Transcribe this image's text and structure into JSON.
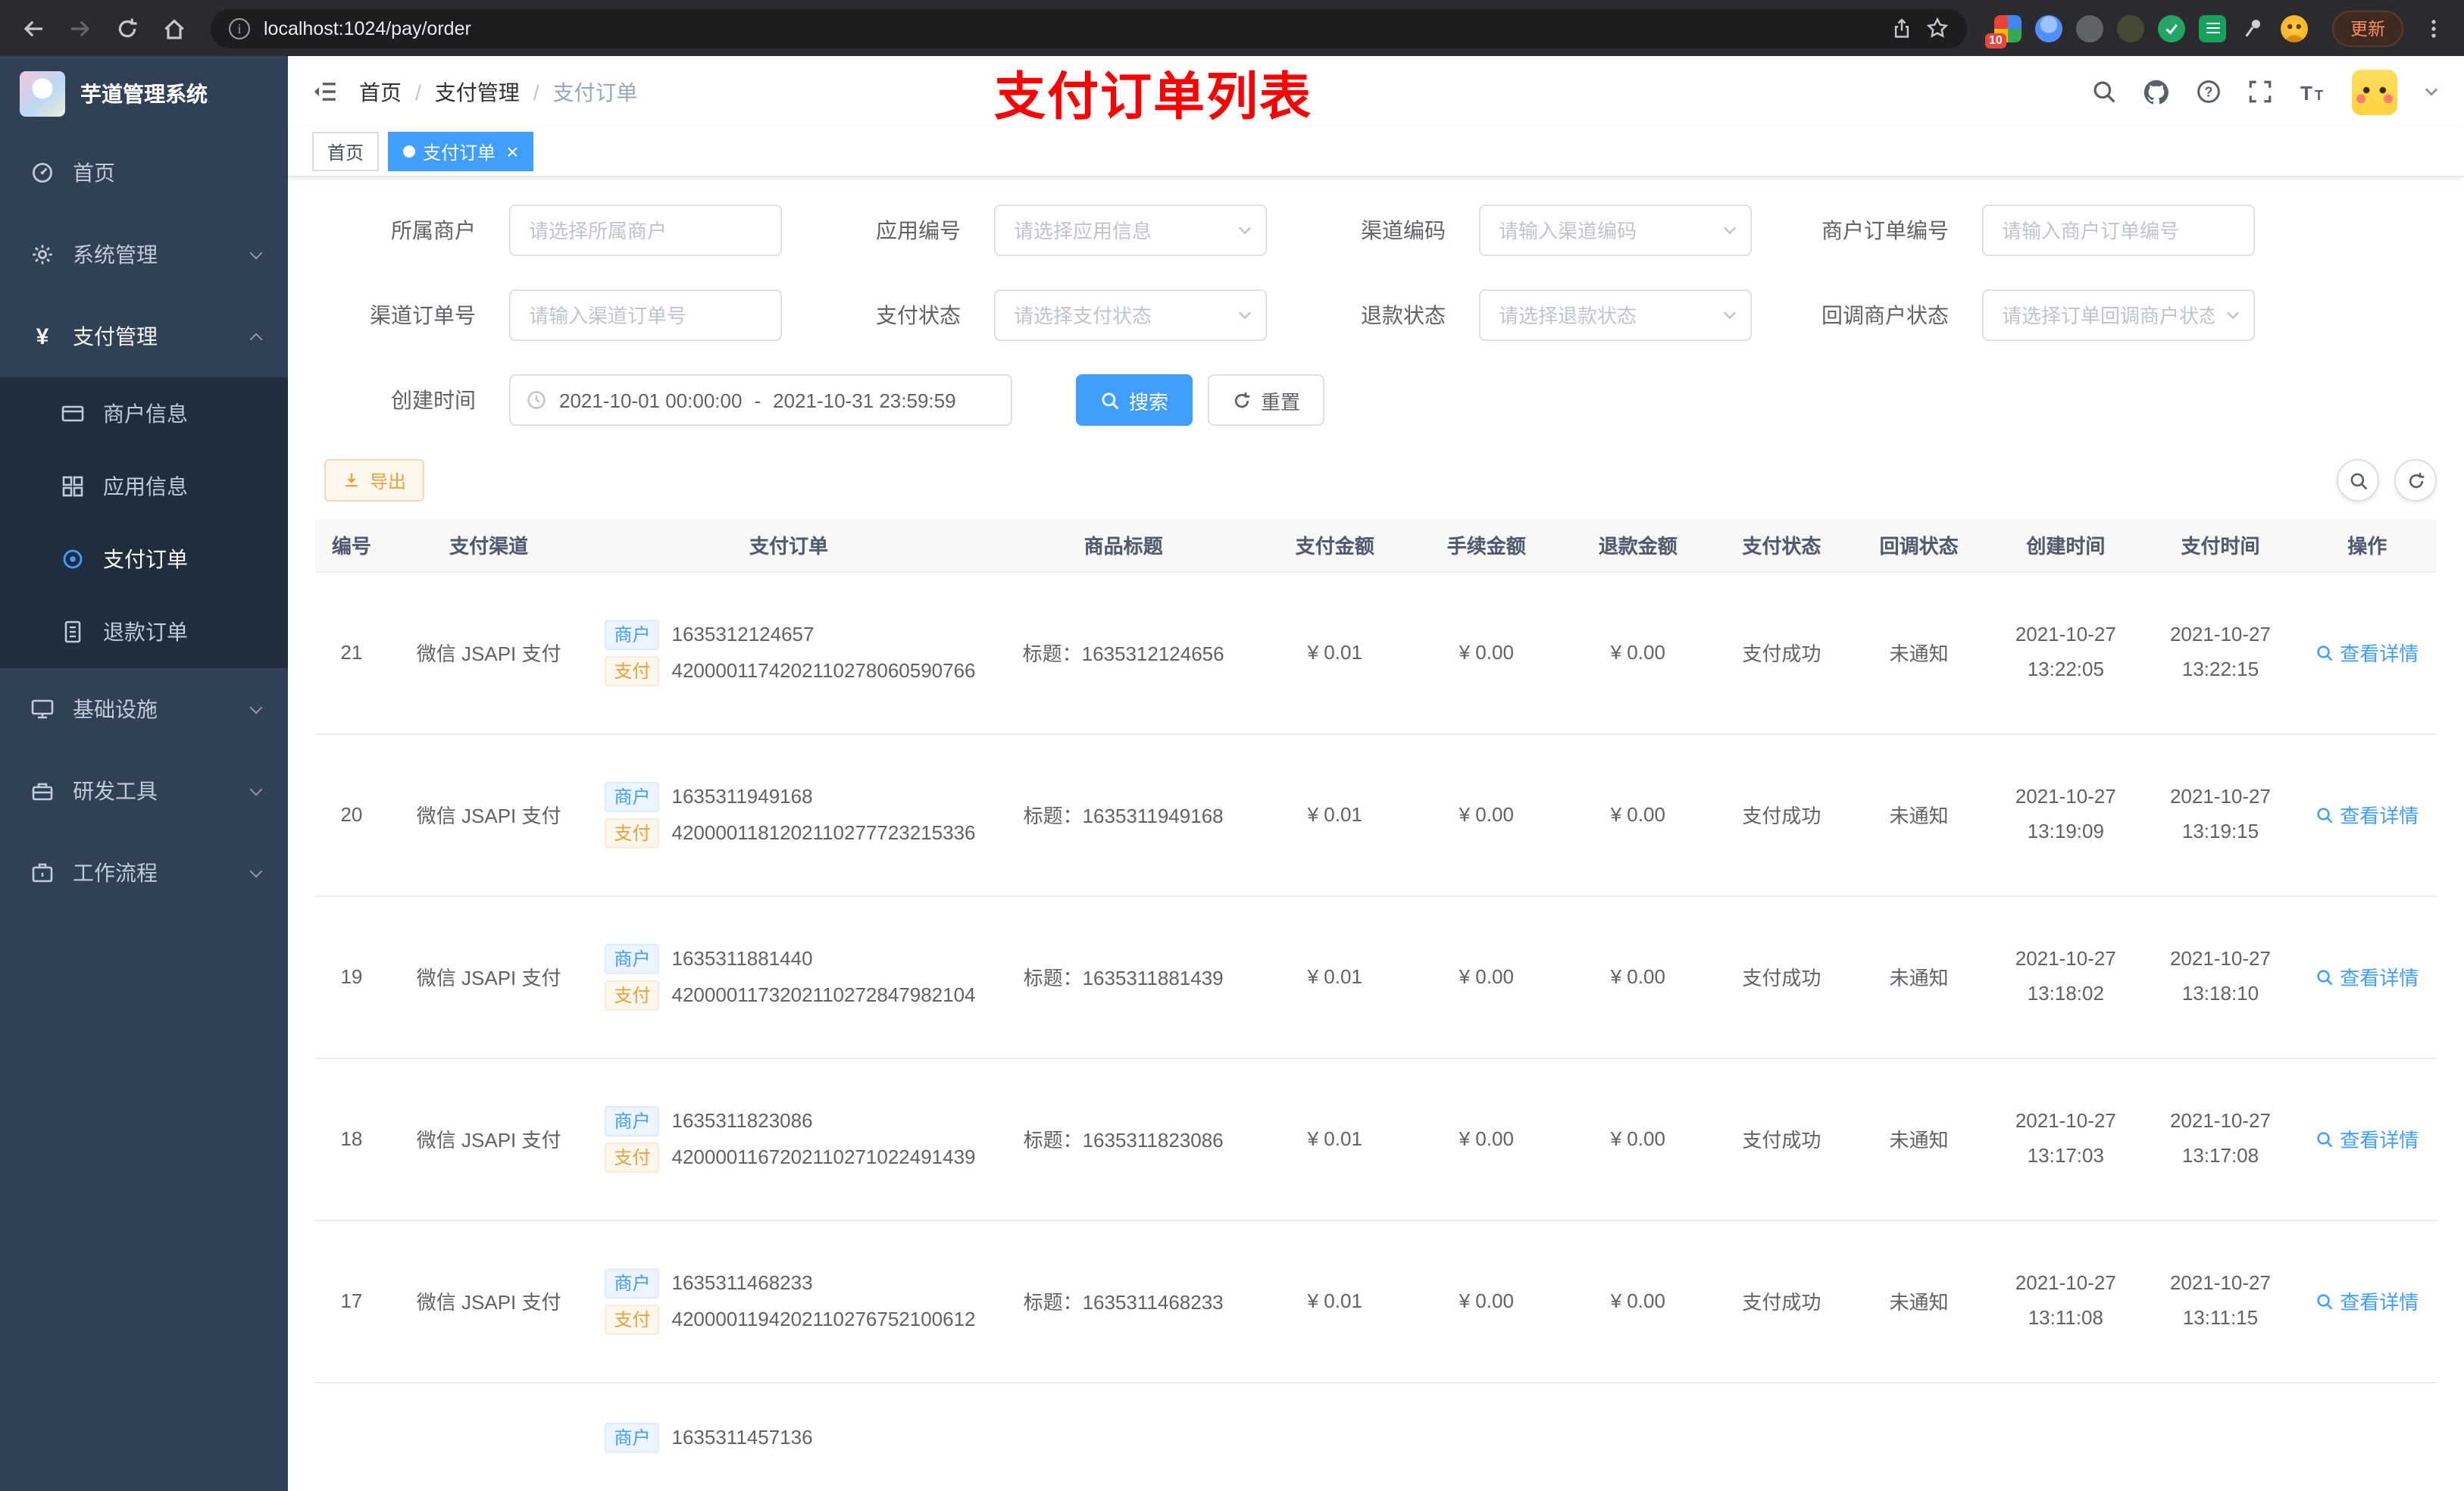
{
  "browser": {
    "url": "localhost:1024/pay/order",
    "update_label": "更新",
    "extension_badge": "10"
  },
  "sidebar": {
    "title": "芋道管理系统",
    "items": [
      {
        "label": "首页"
      },
      {
        "label": "系统管理"
      },
      {
        "label": "支付管理"
      },
      {
        "label": "基础设施"
      },
      {
        "label": "研发工具"
      },
      {
        "label": "工作流程"
      }
    ],
    "sub_items": [
      {
        "label": "商户信息"
      },
      {
        "label": "应用信息"
      },
      {
        "label": "支付订单"
      },
      {
        "label": "退款订单"
      }
    ]
  },
  "header": {
    "breadcrumb": [
      {
        "label": "首页"
      },
      {
        "label": "支付管理"
      },
      {
        "label": "支付订单"
      }
    ],
    "annotation": "支付订单列表"
  },
  "tabs": [
    {
      "label": "首页"
    },
    {
      "label": "支付订单"
    }
  ],
  "filters": {
    "fields": [
      {
        "label": "所属商户",
        "placeholder": "请选择所属商户"
      },
      {
        "label": "应用编号",
        "placeholder": "请选择应用信息"
      },
      {
        "label": "渠道编码",
        "placeholder": "请输入渠道编码"
      },
      {
        "label": "商户订单编号",
        "placeholder": "请输入商户订单编号"
      },
      {
        "label": "渠道订单号",
        "placeholder": "请输入渠道订单号"
      },
      {
        "label": "支付状态",
        "placeholder": "请选择支付状态"
      },
      {
        "label": "退款状态",
        "placeholder": "请选择退款状态"
      },
      {
        "label": "回调商户状态",
        "placeholder": "请选择订单回调商户状态"
      }
    ],
    "date_label": "创建时间",
    "date_start": "2021-10-01 00:00:00",
    "date_separator": "-",
    "date_end": "2021-10-31 23:59:59",
    "search_label": "搜索",
    "reset_label": "重置"
  },
  "toolbar": {
    "export_label": "导出"
  },
  "table": {
    "columns": [
      "编号",
      "支付渠道",
      "支付订单",
      "商品标题",
      "支付金额",
      "手续金额",
      "退款金额",
      "支付状态",
      "回调状态",
      "创建时间",
      "支付时间",
      "操作"
    ],
    "tags": {
      "merchant": "商户",
      "pay": "支付"
    },
    "action_label": "查看详情",
    "rows": [
      {
        "id": "21",
        "channel": "微信 JSAPI 支付",
        "merchant_no": "1635312124657",
        "pay_no": "4200001174202110278060590766",
        "title": "标题：1635312124656",
        "amount": "¥ 0.01",
        "fee": "¥ 0.00",
        "refund": "¥ 0.00",
        "pay_status": "支付成功",
        "notify_status": "未通知",
        "created": "2021-10-27 13:22:05",
        "paid": "2021-10-27 13:22:15"
      },
      {
        "id": "20",
        "channel": "微信 JSAPI 支付",
        "merchant_no": "1635311949168",
        "pay_no": "4200001181202110277723215336",
        "title": "标题：1635311949168",
        "amount": "¥ 0.01",
        "fee": "¥ 0.00",
        "refund": "¥ 0.00",
        "pay_status": "支付成功",
        "notify_status": "未通知",
        "created": "2021-10-27 13:19:09",
        "paid": "2021-10-27 13:19:15"
      },
      {
        "id": "19",
        "channel": "微信 JSAPI 支付",
        "merchant_no": "1635311881440",
        "pay_no": "4200001173202110272847982104",
        "title": "标题：1635311881439",
        "amount": "¥ 0.01",
        "fee": "¥ 0.00",
        "refund": "¥ 0.00",
        "pay_status": "支付成功",
        "notify_status": "未通知",
        "created": "2021-10-27 13:18:02",
        "paid": "2021-10-27 13:18:10"
      },
      {
        "id": "18",
        "channel": "微信 JSAPI 支付",
        "merchant_no": "1635311823086",
        "pay_no": "4200001167202110271022491439",
        "title": "标题：1635311823086",
        "amount": "¥ 0.01",
        "fee": "¥ 0.00",
        "refund": "¥ 0.00",
        "pay_status": "支付成功",
        "notify_status": "未通知",
        "created": "2021-10-27 13:17:03",
        "paid": "2021-10-27 13:17:08"
      },
      {
        "id": "17",
        "channel": "微信 JSAPI 支付",
        "merchant_no": "1635311468233",
        "pay_no": "4200001194202110276752100612",
        "title": "标题：1635311468233",
        "amount": "¥ 0.01",
        "fee": "¥ 0.00",
        "refund": "¥ 0.00",
        "pay_status": "支付成功",
        "notify_status": "未通知",
        "created": "2021-10-27 13:11:08",
        "paid": "2021-10-27 13:11:15"
      }
    ],
    "partial_row": {
      "merchant_no": "1635311457136"
    }
  }
}
